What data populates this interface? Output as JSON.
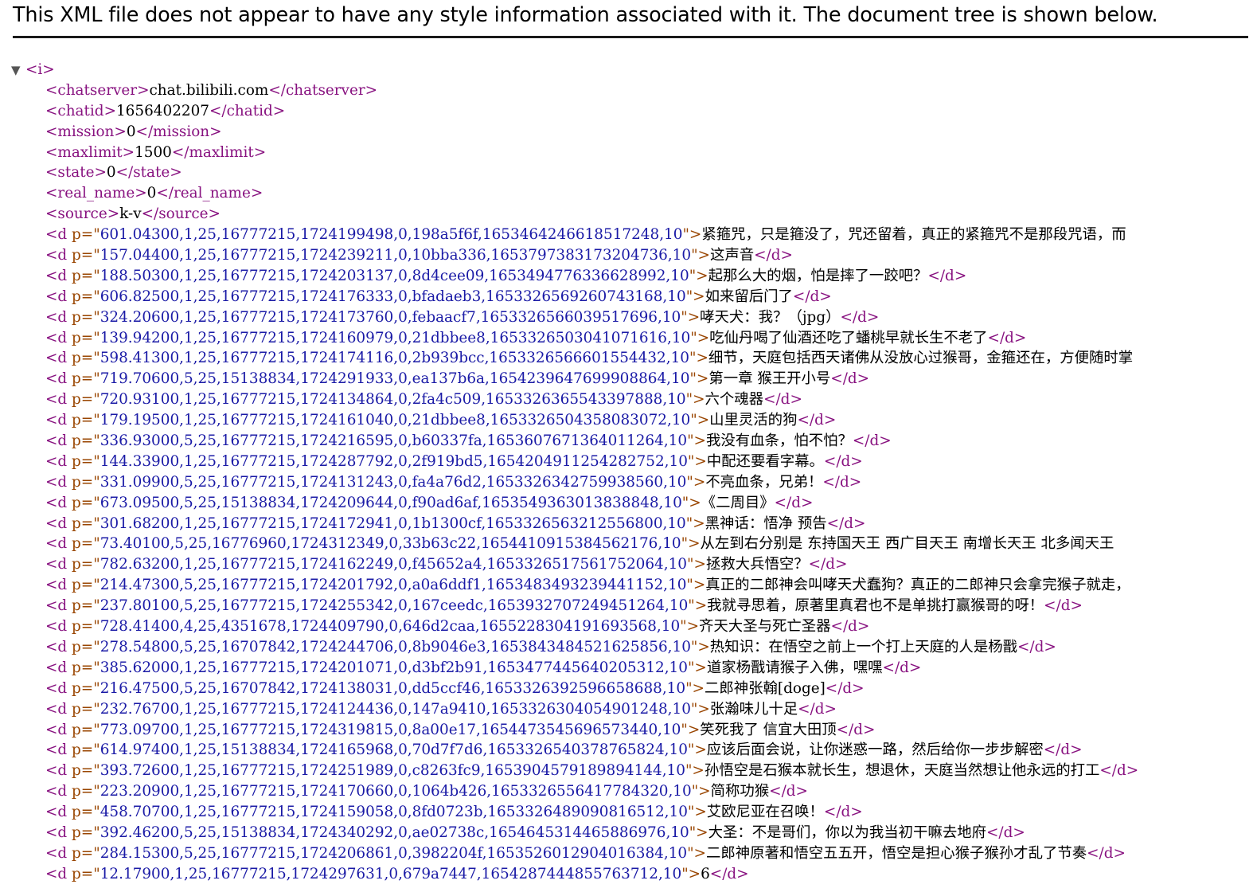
{
  "header": {
    "message": "This XML file does not appear to have any style information associated with it. The document tree is shown below."
  },
  "tree": {
    "toggle_glyph": "▼",
    "root": {
      "open": "<i>"
    },
    "fields": [
      {
        "open": "<chatserver>",
        "value": "chat.bilibili.com",
        "close": "</chatserver>"
      },
      {
        "open": "<chatid>",
        "value": "1656402207",
        "close": "</chatid>"
      },
      {
        "open": "<mission>",
        "value": "0",
        "close": "</mission>"
      },
      {
        "open": "<maxlimit>",
        "value": "1500",
        "close": "</maxlimit>"
      },
      {
        "open": "<state>",
        "value": "0",
        "close": "</state>"
      },
      {
        "open": "<real_name>",
        "value": "0",
        "close": "</real_name>"
      },
      {
        "open": "<source>",
        "value": "k-v",
        "close": "</source>"
      }
    ],
    "d_open_prefix": "<d ",
    "attr_name": "p=\"",
    "attr_close": "\">",
    "d_close": "</d>",
    "danmaku": [
      {
        "p": "601.04300,1,25,16777215,1724199498,0,198a5f6f,1653464246618517248,10",
        "text": "紧箍咒，只是箍没了，咒还留着，真正的紧箍咒不是那段咒语，而",
        "closed": false
      },
      {
        "p": "157.04400,1,25,16777215,1724239211,0,10bba336,1653797383173204736,10",
        "text": "这声音",
        "closed": true
      },
      {
        "p": "188.50300,1,25,16777215,1724203137,0,8d4cee09,1653494776336628992,10",
        "text": "起那么大的烟，怕是摔了一跤吧？",
        "closed": true
      },
      {
        "p": "606.82500,1,25,16777215,1724176333,0,bfadaeb3,1653326569260743168,10",
        "text": "如来留后门了",
        "closed": true
      },
      {
        "p": "324.20600,1,25,16777215,1724173760,0,febaacf7,1653326566039517696,10",
        "text": "哮天犬：我？（jpg）",
        "closed": true
      },
      {
        "p": "139.94200,1,25,16777215,1724160979,0,21dbbee8,1653326503041071616,10",
        "text": "吃仙丹喝了仙酒还吃了蟠桃早就长生不老了",
        "closed": true
      },
      {
        "p": "598.41300,1,25,16777215,1724174116,0,2b939bcc,1653326566601554432,10",
        "text": "细节，天庭包括西天诸佛从没放心过猴哥，金箍还在，方便随时掌",
        "closed": false
      },
      {
        "p": "719.70600,5,25,15138834,1724291933,0,ea137b6a,1654239647699908864,10",
        "text": "第一章 猴王开小号",
        "closed": true
      },
      {
        "p": "720.93100,1,25,16777215,1724134864,0,2fa4c509,1653326365543397888,10",
        "text": "六个魂器",
        "closed": true
      },
      {
        "p": "179.19500,1,25,16777215,1724161040,0,21dbbee8,1653326504358083072,10",
        "text": "山里灵活的狗",
        "closed": true
      },
      {
        "p": "336.93000,5,25,16777215,1724216595,0,b60337fa,1653607671364011264,10",
        "text": "我没有血条，怕不怕？",
        "closed": true
      },
      {
        "p": "144.33900,1,25,16777215,1724287792,0,2f919bd5,1654204911254282752,10",
        "text": "中配还要看字幕。",
        "closed": true
      },
      {
        "p": "331.09900,5,25,16777215,1724131243,0,fa4a76d2,1653326342759938560,10",
        "text": "不亮血条，兄弟！",
        "closed": true
      },
      {
        "p": "673.09500,5,25,15138834,1724209644,0,f90ad6af,1653549363013838848,10",
        "text": "《二周目》",
        "closed": true
      },
      {
        "p": "301.68200,1,25,16777215,1724172941,0,1b1300cf,1653326563212556800,10",
        "text": "黑神话：悟净 预告",
        "closed": true
      },
      {
        "p": "73.40100,5,25,16776960,1724312349,0,33b63c22,1654410915384562176,10",
        "text": "从左到右分别是 东持国天王 西广目天王 南增长天王 北多闻天王",
        "closed": false
      },
      {
        "p": "782.63200,1,25,16777215,1724162249,0,f45652a4,1653326517561752064,10",
        "text": "拯救大兵悟空？",
        "closed": true
      },
      {
        "p": "214.47300,5,25,16777215,1724201792,0,a0a6ddf1,1653483493239441152,10",
        "text": "真正的二郎神会叫哮天犬蠢狗？真正的二郎神只会拿完猴子就走，",
        "closed": false
      },
      {
        "p": "237.80100,5,25,16777215,1724255342,0,167ceedc,1653932707249451264,10",
        "text": "我就寻思着，原著里真君也不是单挑打赢猴哥的呀！",
        "closed": true
      },
      {
        "p": "728.41400,4,25,4351678,1724409790,0,646d2caa,1655228304191693568,10",
        "text": "齐天大圣与死亡圣器",
        "closed": true
      },
      {
        "p": "278.54800,5,25,16707842,1724244706,0,8b9046e3,1653843484521625856,10",
        "text": "热知识：在悟空之前上一个打上天庭的人是杨戬",
        "closed": true
      },
      {
        "p": "385.62000,1,25,16777215,1724201071,0,d3bf2b91,1653477445640205312,10",
        "text": "道家杨戬请猴子入佛，嘿嘿",
        "closed": true
      },
      {
        "p": "216.47500,5,25,16707842,1724138031,0,dd5ccf46,1653326392596658688,10",
        "text": "二郎神张翰[doge]",
        "closed": true
      },
      {
        "p": "232.76700,1,25,16777215,1724124436,0,147a9410,1653326304054901248,10",
        "text": "张瀚味儿十足",
        "closed": true
      },
      {
        "p": "773.09700,1,25,16777215,1724319815,0,8a00e17,1654473545696573440,10",
        "text": "笑死我了 信宜大田顶",
        "closed": true
      },
      {
        "p": "614.97400,1,25,15138834,1724165968,0,70d7f7d6,1653326540378765824,10",
        "text": "应该后面会说，让你迷惑一路，然后给你一步步解密",
        "closed": true
      },
      {
        "p": "393.72600,1,25,16777215,1724251989,0,c8263fc9,1653904579189894144,10",
        "text": "孙悟空是石猴本就长生，想退休，天庭当然想让他永远的打工",
        "closed": true
      },
      {
        "p": "223.20900,1,25,16777215,1724170660,0,1064b426,1653326556417784320,10",
        "text": "简称功猴",
        "closed": true
      },
      {
        "p": "458.70700,1,25,16777215,1724159058,0,8fd0723b,1653326489090816512,10",
        "text": "艾欧尼亚在召唤！",
        "closed": true
      },
      {
        "p": "392.46200,5,25,15138834,1724340292,0,ae02738c,1654645314465886976,10",
        "text": "大圣：不是哥们，你以为我当初干嘛去地府",
        "closed": true
      },
      {
        "p": "284.15300,5,25,16777215,1724206861,0,3982204f,1653526012904016384,10",
        "text": "二郎神原著和悟空五五开，悟空是担心猴子猴孙才乱了节奏",
        "closed": true
      },
      {
        "p": "12.17900,1,25,16777215,1724297631,0,679a7447,1654287444855763712,10",
        "text": "6",
        "closed": true
      }
    ]
  }
}
